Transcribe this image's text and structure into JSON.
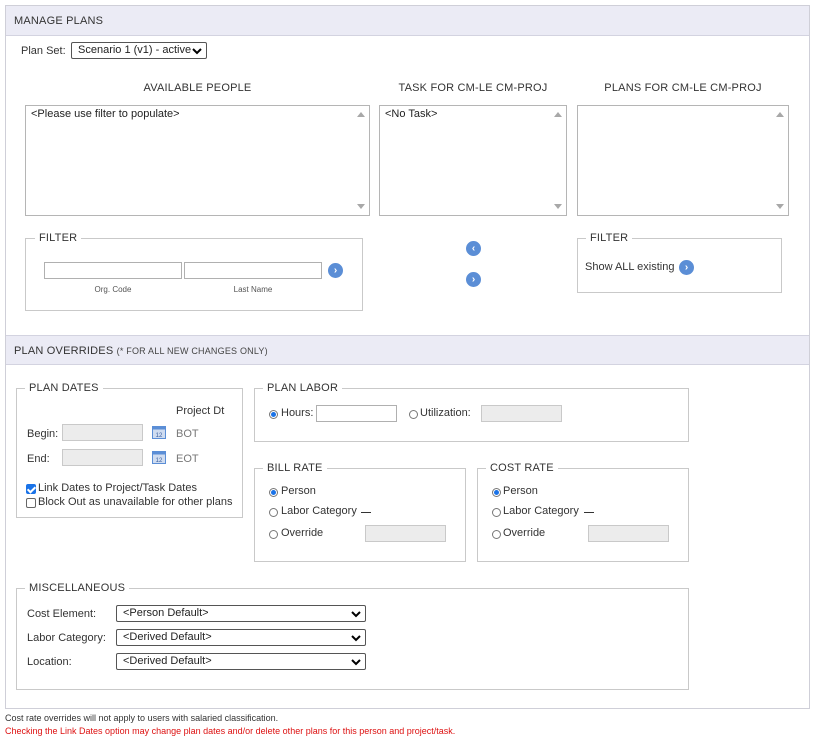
{
  "manage_plans": {
    "title": "MANAGE PLANS",
    "plan_set_label": "Plan Set:",
    "plan_set_value": "Scenario 1 (v1) - active",
    "available_people": {
      "heading": "AVAILABLE PEOPLE",
      "items": [
        "<Please use filter to populate>"
      ]
    },
    "task": {
      "heading": "TASK FOR CM-LE CM-PROJ",
      "items": [
        "<No Task>"
      ]
    },
    "plans": {
      "heading": "PLANS FOR CM-LE CM-PROJ",
      "items": []
    },
    "filter_left": {
      "title": "FILTER",
      "org_code_label": "Org. Code",
      "last_name_label": "Last Name",
      "org_code_value": "",
      "last_name_value": ""
    },
    "filter_right": {
      "title": "FILTER",
      "show_all_label": "Show ALL existing"
    }
  },
  "overrides": {
    "title": "PLAN OVERRIDES",
    "subtitle": "(* FOR ALL NEW CHANGES ONLY)",
    "plan_dates": {
      "title": "PLAN DATES",
      "project_dt_label": "Project Dt",
      "begin_label": "Begin:",
      "end_label": "End:",
      "begin_value": "",
      "end_value": "",
      "begin_project": "BOT",
      "end_project": "EOT",
      "link_dates_label": "Link Dates to Project/Task Dates",
      "link_dates_checked": true,
      "block_out_label": "Block Out as unavailable for other plans",
      "block_out_checked": false
    },
    "plan_labor": {
      "title": "PLAN LABOR",
      "hours_label": "Hours:",
      "utilization_label": "Utilization:",
      "selected": "hours"
    },
    "bill_rate": {
      "title": "BILL RATE",
      "person_label": "Person",
      "labor_category_label": "Labor Category",
      "override_label": "Override",
      "selected": "person"
    },
    "cost_rate": {
      "title": "COST RATE",
      "person_label": "Person",
      "labor_category_label": "Labor Category",
      "override_label": "Override",
      "selected": "person"
    },
    "misc": {
      "title": "MISCELLANEOUS",
      "cost_element_label": "Cost Element:",
      "cost_element_value": "<Person Default>",
      "labor_category_label": "Labor Category:",
      "labor_category_value": "<Derived Default>",
      "location_label": "Location:",
      "location_value": "<Derived Default>"
    }
  },
  "footer": {
    "note": "Cost rate overrides will not apply to users with salaried classification.",
    "warning": "Checking the Link Dates option may change plan dates and/or delete other plans for this person and project/task."
  },
  "colors": {
    "accent": "#5b8ed6",
    "header_bg": "#ebebf5",
    "warning": "#dd1111"
  }
}
